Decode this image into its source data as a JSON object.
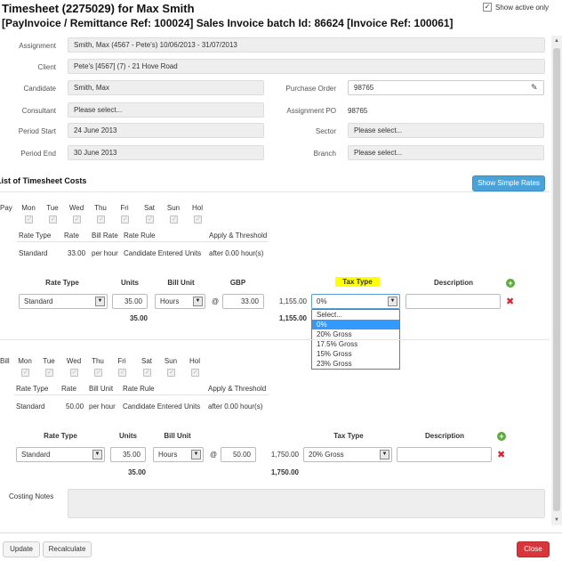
{
  "header": {
    "title": "Timesheet (2275029) for Max Smith",
    "subtitle": "[PayInvoice / Remittance Ref: 100024] Sales Invoice batch Id: 86624 [Invoice Ref: 100061]",
    "show_active_label": "Show active only",
    "show_active_checked": true
  },
  "details": {
    "assignment_label": "Assignment",
    "assignment_value": "Smith, Max (4567 - Pete's) 10/06/2013 - 31/07/2013",
    "client_label": "Client",
    "client_value": "Pete's [4567] (7) - 21 Hove Road",
    "candidate_label": "Candidate",
    "candidate_value": "Smith, Max",
    "consultant_label": "Consultant",
    "consultant_value": "Please select...",
    "period_start_label": "Period Start",
    "period_start_value": "24 June 2013",
    "period_end_label": "Period End",
    "period_end_value": "30 June 2013",
    "purchase_order_label": "Purchase Order",
    "purchase_order_value": "98765",
    "assignment_po_label": "Assignment PO",
    "assignment_po_value": "98765",
    "sector_label": "Sector",
    "sector_value": "Please select...",
    "branch_label": "Branch",
    "branch_value": "Please select..."
  },
  "costs": {
    "title": "List of Timesheet Costs",
    "show_rates_button": "Show Simple Rates"
  },
  "days": [
    "Mon",
    "Tue",
    "Wed",
    "Thu",
    "Fri",
    "Sat",
    "Sun",
    "Hol"
  ],
  "summary_headers": {
    "rate_type": "Rate Type",
    "rate": "Rate",
    "bill_rate": "Bill Rate",
    "bill_unit": "Bill Unit",
    "rate_rule": "Rate Rule",
    "apply_threshold": "Apply & Threshold"
  },
  "pay": {
    "label": "Pay",
    "rate_type": "Standard",
    "rate": "33.00",
    "per": "per hour",
    "rule": "Candidate Entered Units",
    "threshold": "after 0.00 hour(s)",
    "grid": {
      "rate_type_h": "Rate Type",
      "units_h": "Units",
      "bill_unit_h": "Bill Unit",
      "currency_h": "GBP",
      "tax_type_h": "Tax Type",
      "description_h": "Description",
      "rate_type_val": "Standard",
      "units_val": "35.00",
      "unit_val": "Hours",
      "at": "@",
      "rate_val": "33.00",
      "total_val": "1,155.00",
      "tax_val": "0%",
      "units_total": "35.00",
      "grand_total": "1,155.00"
    },
    "tax_options": [
      "Select...",
      "0%",
      "20% Gross",
      "17.5% Gross",
      "15% Gross",
      "23% Gross"
    ]
  },
  "bill": {
    "label": "Bill",
    "rate_type": "Standard",
    "rate": "50.00",
    "per": "per hour",
    "rule": "Candidate Entered Units",
    "threshold": "after 0.00 hour(s)",
    "grid": {
      "rate_type_h": "Rate Type",
      "units_h": "Units",
      "bill_unit_h": "Bill Unit",
      "tax_type_h": "Tax Type",
      "description_h": "Description",
      "rate_type_val": "Standard",
      "units_val": "35.00",
      "unit_val": "Hours",
      "at": "@",
      "rate_val": "50.00",
      "total_val": "1,750.00",
      "tax_val": "20% Gross",
      "units_total": "35.00",
      "grand_total": "1,750.00"
    }
  },
  "notes": {
    "label": "Costing Notes"
  },
  "footer": {
    "update": "Update",
    "recalculate": "Recalculate",
    "close": "Close"
  },
  "colors": {
    "primary_blue": "#4aa3d8",
    "close_red": "#d9353a",
    "highlight_yellow": "#ffff00",
    "add_green": "#5aab3a",
    "delete_red": "#d9232f"
  }
}
